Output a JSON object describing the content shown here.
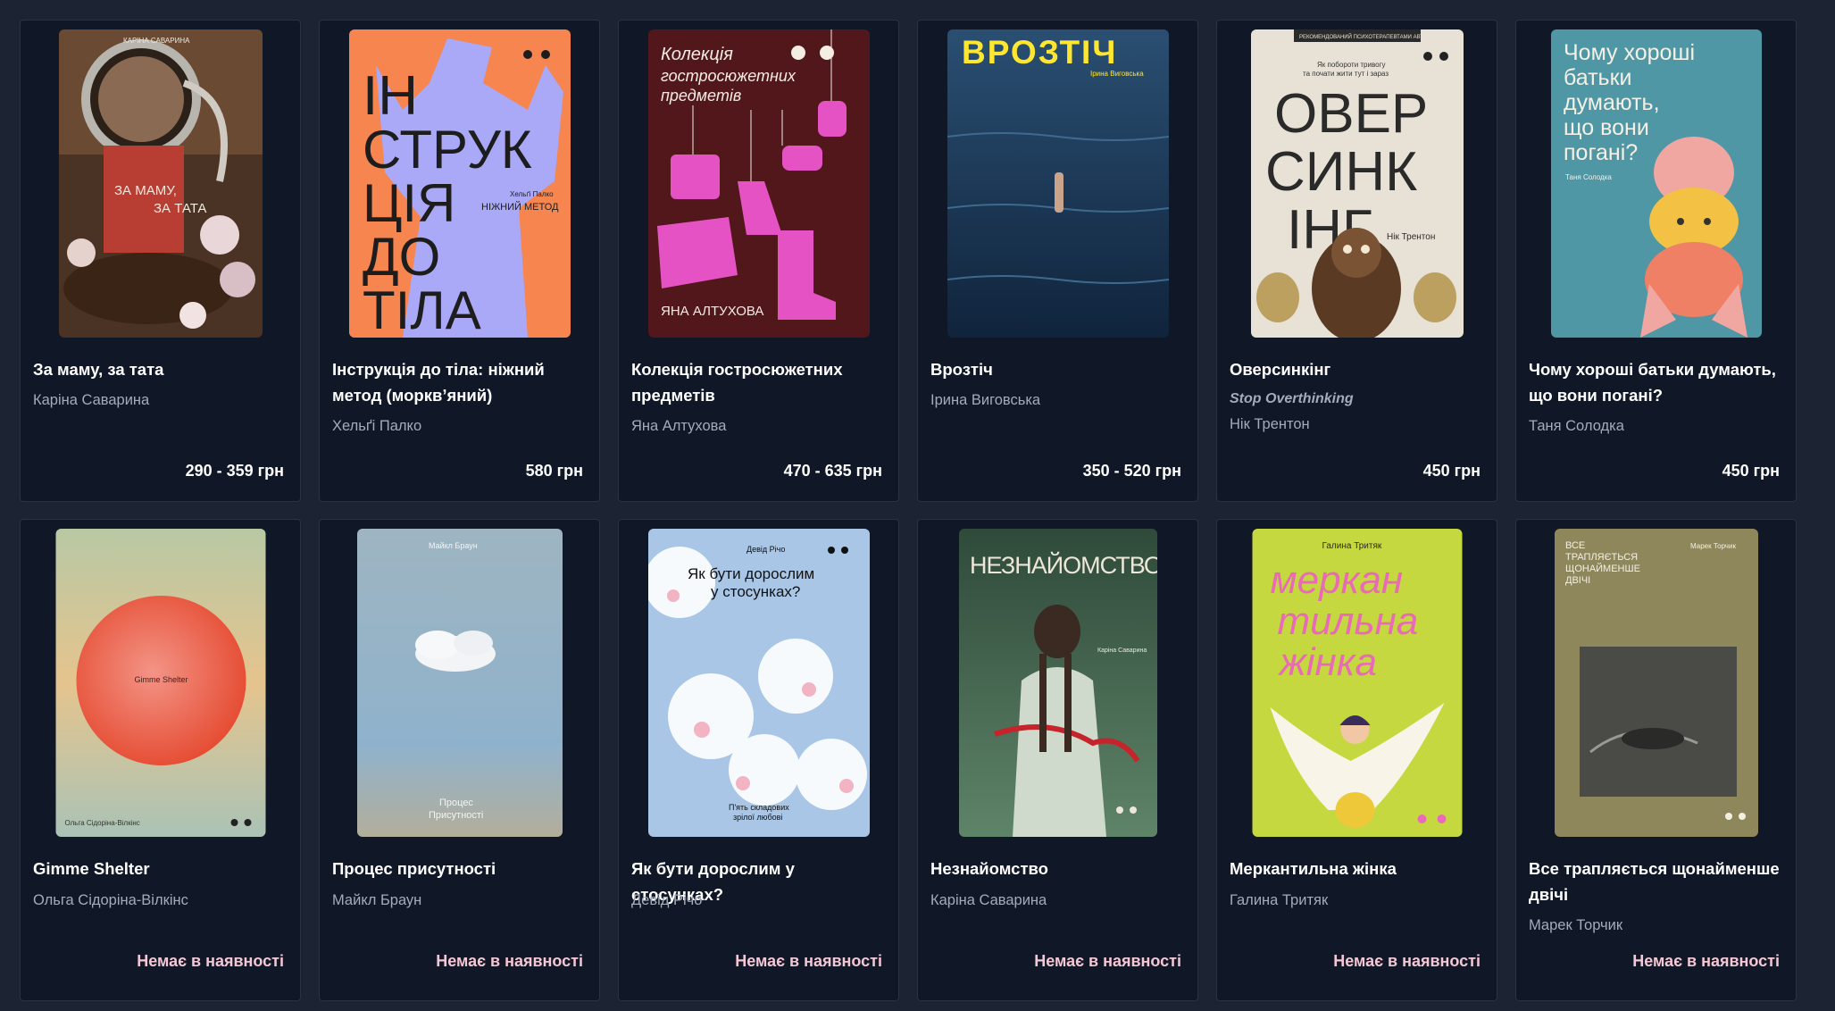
{
  "products": [
    {
      "title": "За маму, за тата",
      "author": "Каріна Саварина",
      "price": "290 - 359 грн",
      "cover": {
        "bg": "#5a3a28",
        "title": "ЗА МАМУ,\nЗА ТАТА",
        "author": "КАРІНА САВАРИНА",
        "text_color": "#f3e9df"
      }
    },
    {
      "title": "Інструкція до тіла: ніжний метод (морквʼяний)",
      "author": "Хельґі Палко",
      "price": "580 грн",
      "cover": {
        "bg": "#f6854f",
        "figure": "#a9a9f7",
        "title_lines": [
          "ІН",
          "СТРУК",
          "ЦІЯ",
          "ДО",
          "ТІЛА"
        ],
        "author": "Хельґі Палко",
        "subtitle": "НІЖНИЙ МЕТОД"
      }
    },
    {
      "title": "Колекція гостросюжетних предметів",
      "author": "Яна Алтухова",
      "price": "470 - 635 грн",
      "cover": {
        "bg": "#51171b",
        "accent": "#e552c4",
        "title_lines": [
          "Колекція",
          "гостросюжетних",
          "предметів"
        ],
        "author": "ЯНА АЛТУХОВА"
      }
    },
    {
      "title": "Врозтіч",
      "author": "Ірина Виговська",
      "price": "350 - 520 грн",
      "cover": {
        "bg": "#1d3a5c",
        "title": "ВРОЗТІЧ",
        "title_color": "#ffe731",
        "author": "Ірина Виговська"
      }
    },
    {
      "title": "Оверсинкінг",
      "subtitle": "Stop Overthinking",
      "author": "Нік Трентон",
      "price": "450 грн",
      "cover": {
        "bg": "#e8e2d6",
        "banner": "РЕКОМЕНДОВАНИЙ ПСИХОТЕРАПЕВТАМИ АВТОР",
        "tagline": [
          "Як побороти тривогу",
          "та почати жити тут і зараз"
        ],
        "title_lines": [
          "ОВЕР",
          "СИНК",
          "ІНГ"
        ],
        "author": "Нік Трентон"
      }
    },
    {
      "title": "Чому хороші батьки думають, що вони погані?",
      "author": "Таня Солодка",
      "price": "450 грн",
      "cover": {
        "bg": "#4f97a4",
        "title_lines": [
          "Чому хороші",
          "батьки",
          "думають,",
          "що вони",
          "погані?"
        ],
        "author": "Таня Солодка"
      }
    },
    {
      "title": "Gimme Shelter",
      "author": "Ольга Сідоріна-Вілкінс",
      "price": "Немає в наявності",
      "cover": {
        "bg": "#d7c48d",
        "circle": "#ea5a46",
        "title": "Gimme Shelter",
        "author": "Ольга Сідоріна-Вілкінс"
      }
    },
    {
      "title": "Процес присутності",
      "author": "Майкл Браун",
      "price": "Немає в наявності",
      "cover": {
        "bg": "#9fb9ca",
        "title_lines": [
          "Процес",
          "Присутності"
        ],
        "author": "Майкл Браун"
      }
    },
    {
      "title": "Як бути дорослим у стосунках?",
      "author": "Девід Річо",
      "price": "Немає в наявності",
      "cover": {
        "bg": "#a9c6e6",
        "title_lines": [
          "Як бути дорослим",
          "у стосунках?"
        ],
        "tagline": [
          "П'ять складових",
          "зрілої любові"
        ],
        "author": "Девід Річо"
      }
    },
    {
      "title": "Незнайомство",
      "author": "Каріна Саварина",
      "price": "Немає в наявності",
      "cover": {
        "bg": "#4d6f57",
        "title": "НЕЗНАЙОМСТВО",
        "author": "Каріна Саварина"
      }
    },
    {
      "title": "Меркантильна жінка",
      "author": "Галина Тритяк",
      "price": "Немає в наявності",
      "cover": {
        "bg": "#c6d83f",
        "title_lines": [
          "меркан",
          "тильна",
          "жінка"
        ],
        "title_color": "#e96bb7",
        "author": "Галина Тритяк"
      }
    },
    {
      "title": "Все трапляється щонайменше двічі",
      "author": "Марек Торчик",
      "price": "Немає в наявності",
      "cover": {
        "bg": "#8f875c",
        "title_lines": [
          "ВСЕ",
          "ТРАПЛЯЄТЬСЯ",
          "ЩОНАЙМЕНШЕ",
          "ДВІЧІ"
        ],
        "author": "Марек Торчик"
      }
    }
  ]
}
